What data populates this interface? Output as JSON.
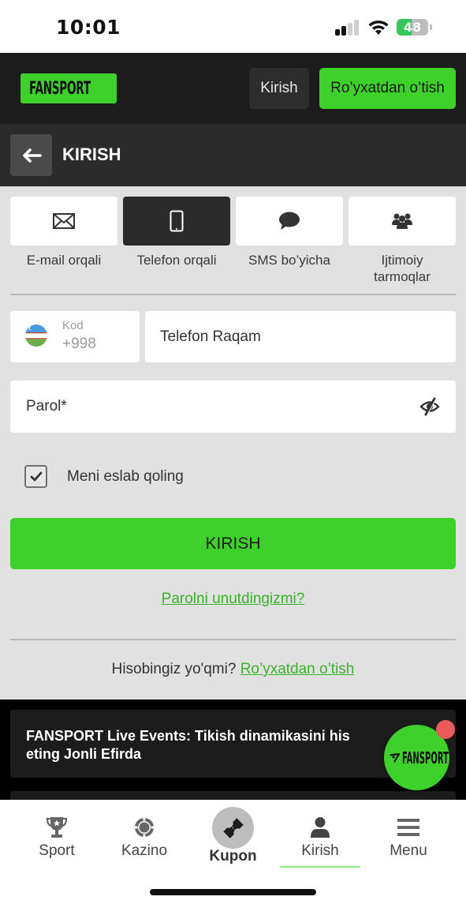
{
  "status_bar": {
    "time": "10:01",
    "battery_percent": "48",
    "battery_level": 0.48,
    "signal_bars_active": 2,
    "signal_bars_total": 4
  },
  "header": {
    "logo_text": "FANSPORT",
    "login_label": "Kirish",
    "register_label": "Ro’yxatdan o’tish"
  },
  "titlebar": {
    "back_icon": "arrow-left-icon",
    "title": "KIRISH"
  },
  "methods": [
    {
      "label": "E-mail orqali",
      "icon": "envelope-icon",
      "active": false
    },
    {
      "label": "Telefon orqali",
      "icon": "phone-icon",
      "active": true
    },
    {
      "label": "SMS bo’yicha",
      "icon": "chat-bubble-icon",
      "active": false
    },
    {
      "label": "Ijtimoiy tarmoqlar",
      "icon": "users-icon",
      "active": false
    }
  ],
  "form": {
    "country_code_label": "Kod",
    "country_code_value": "+998",
    "country_flag": "uzbekistan-flag-icon",
    "phone_placeholder": "Telefon Raqam",
    "password_placeholder": "Parol*",
    "password_toggle_icon": "eye-slash-icon",
    "remember_label": "Meni eslab qoling",
    "remember_checked": true,
    "submit_label": "KIRISH",
    "forgot_link": "Parolni unutdingizmi?",
    "no_account_text": "Hisobingiz yo'qmi?",
    "register_link": "Ro’yxatdan o’tish"
  },
  "promo": {
    "text": "FANSPORT Live Events: Tikish dinamikasini his eting Jonli Efirda",
    "fab_text": "FANSPORT"
  },
  "bottom_nav": {
    "items": [
      {
        "label": "Sport",
        "icon": "trophy-icon"
      },
      {
        "label": "Kazino",
        "icon": "casino-chip-icon"
      },
      {
        "label": "Kupon",
        "icon": "ticket-icon"
      },
      {
        "label": "Kirish",
        "icon": "user-icon",
        "active": true
      },
      {
        "label": "Menu",
        "icon": "hamburger-menu-icon"
      }
    ]
  },
  "colors": {
    "brand_green": "#3fd12b",
    "link_green": "#3bb22b",
    "header_dark": "#1c1c1c",
    "background": "#e1e1e1",
    "badge_red": "#ea5a5a"
  }
}
